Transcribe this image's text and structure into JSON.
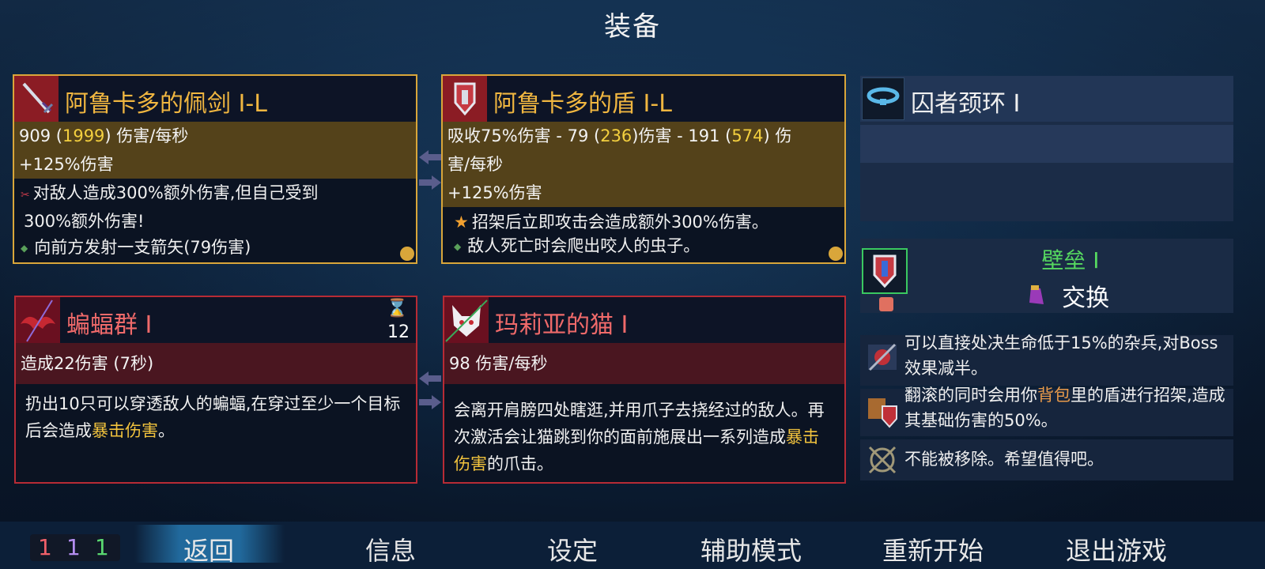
{
  "screen_title": "装备",
  "cards": {
    "sword": {
      "name": "阿鲁卡多的佩剑 I-L",
      "dps": "909",
      "dps_alt": "1999",
      "dps_unit": "伤害/每秒",
      "bonus": "+125%伤害",
      "affix1": "对敌人造成300%额外伤害,但自己受到",
      "affix1_cont": "300%额外伤害!",
      "affix2": "向前方发射一支箭矢(79伤害)"
    },
    "shield": {
      "name": "阿鲁卡多的盾 I-L",
      "l1_pre": "吸收75%伤害 - 79 (",
      "l1_a": "236",
      "l1_mid": ")伤害 - 191 (",
      "l1_b": "574",
      "l1_post": ") 伤",
      "l2": "害/每秒",
      "bonus": "+125%伤害",
      "affix1": "招架后立即攻击会造成额外300%伤害。",
      "affix2": "敌人死亡时会爬出咬人的虫子。"
    },
    "bats": {
      "name": "蝙蝠群 I",
      "cooldown": "12",
      "stat": "造成22伤害 (7秒)",
      "desc_a": "扔出10只可以穿透敌人的蝙蝠,在穿过至少一个目标后会造成",
      "desc_crit": "暴击伤害",
      "desc_b": "。"
    },
    "cat": {
      "name": "玛莉亚的猫 I",
      "stat": "98 伤害/每秒",
      "desc_a": "会离开肩膀四处瞎逛,并用爪子去挠经过的敌人。再次激活会让猫跳到你的面前施展出一系列造成",
      "desc_crit": "暴击伤害",
      "desc_b": "的爪击。"
    }
  },
  "amulet": {
    "name": "囚者颈环 I"
  },
  "mutation": {
    "name": "壁垒 I",
    "swap_label": "交换",
    "effects": [
      {
        "text": "可以直接处决生命低于15%的杂兵,对Boss效果减半。"
      },
      {
        "pre": "翻滚的同时会用你",
        "hl": "背包",
        "post": "里的盾进行招架,造成其基础伤害的50%。"
      },
      {
        "text": "不能被移除。希望值得吧。"
      }
    ]
  },
  "counter": {
    "a": "1",
    "b": "1",
    "c": "1"
  },
  "menu": {
    "back": "返回",
    "info": "信息",
    "settings": "设定",
    "assist": "辅助模式",
    "restart": "重新开始",
    "quit": "退出游戏"
  },
  "colors": {
    "gold_border": "#d9a63a",
    "red_border": "#b72b35",
    "crit_yellow": "#f2c33d",
    "mutation_green": "#56d860"
  }
}
